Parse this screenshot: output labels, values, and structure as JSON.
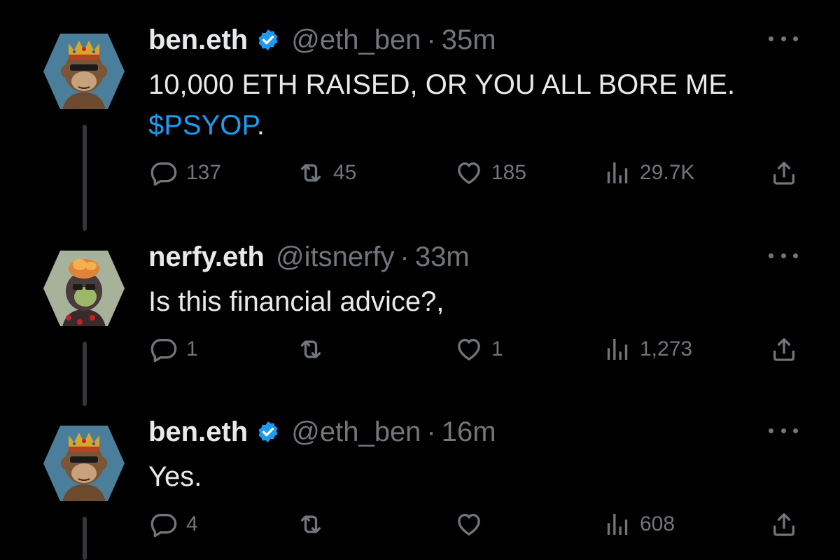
{
  "colors": {
    "background": "#000000",
    "text_primary": "#e7e9ea",
    "text_secondary": "#71767b",
    "link": "#1d9bf0",
    "verified": "#1d9bf0",
    "thread_line": "#333639"
  },
  "tweets": [
    {
      "name": "ben.eth",
      "verified": true,
      "handle": "@eth_ben",
      "separator": "·",
      "time": "35m",
      "text": "10,000 ETH RAISED, OR YOU ALL BORE ME.",
      "cashtag": "$PSYOP",
      "text_suffix": ".",
      "avatar": "ape-king-avatar",
      "stats": {
        "replies": "137",
        "retweets": "45",
        "likes": "185",
        "views": "29.7K"
      }
    },
    {
      "name": "nerfy.eth",
      "verified": false,
      "handle": "@itsnerfy",
      "separator": "·",
      "time": "33m",
      "text": "Is this financial advice?,",
      "avatar": "ape-zombie-avatar",
      "stats": {
        "replies": "1",
        "retweets": "",
        "likes": "1",
        "views": "1,273"
      }
    },
    {
      "name": "ben.eth",
      "verified": true,
      "handle": "@eth_ben",
      "separator": "·",
      "time": "16m",
      "text": "Yes.",
      "avatar": "ape-king-avatar",
      "stats": {
        "replies": "4",
        "retweets": "",
        "likes": "",
        "views": "608"
      }
    }
  ],
  "icons": {
    "reply": "reply-icon",
    "retweet": "retweet-icon",
    "like": "heart-icon",
    "views": "views-icon",
    "share": "share-icon",
    "more": "more-icon",
    "verified": "verified-badge-icon"
  }
}
